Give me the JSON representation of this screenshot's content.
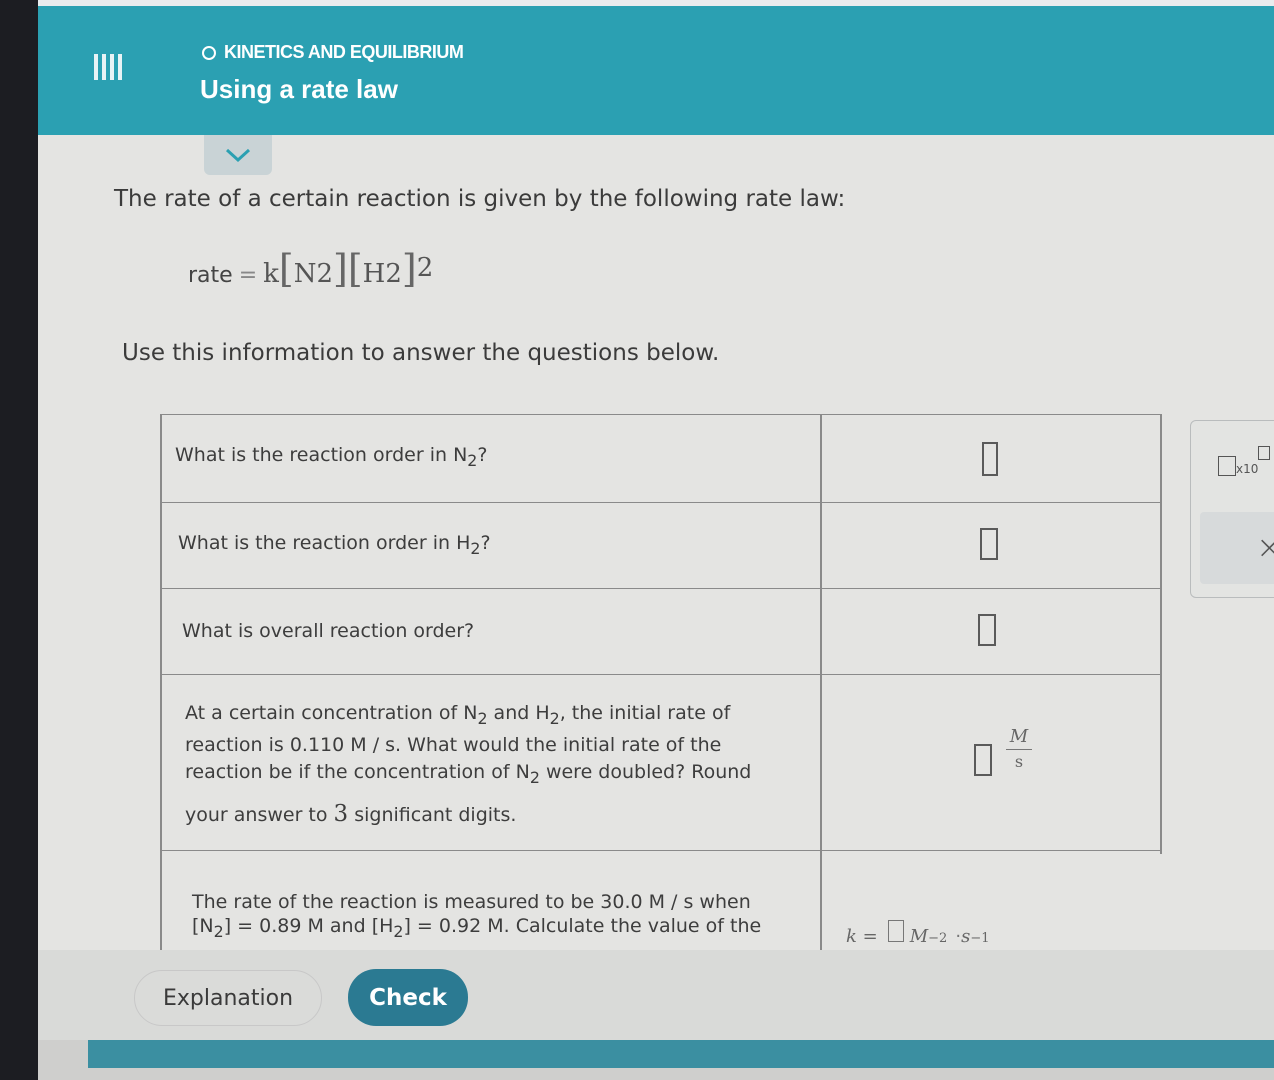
{
  "header": {
    "topic": "KINETICS AND EQUILIBRIUM",
    "title": "Using a rate law"
  },
  "intro": "The rate of a certain reaction is given by the following rate law:",
  "rate_law": {
    "lhs": "rate",
    "eq": "=",
    "k": "k",
    "n": "N",
    "h": "H",
    "sub": "2",
    "exp": "2"
  },
  "use_info": "Use this information to answer the questions below.",
  "questions": {
    "q1": {
      "pre": "What is the reaction order in N",
      "sub": "2",
      "post": "?"
    },
    "q2": {
      "pre": "What is the reaction order in H",
      "sub": "2",
      "post": "?"
    },
    "q3": {
      "text": "What is overall reaction order?"
    },
    "q4": {
      "l1a": "At a certain concentration of N",
      "l1sub1": "2",
      "l1b": " and H",
      "l1sub2": "2",
      "l1c": ", the initial rate of",
      "l2": "reaction is 0.110 M / s. What would the initial rate of the",
      "l3a": "reaction be if the concentration of N",
      "l3sub": "2",
      "l3b": " were doubled? Round",
      "l4a": "your answer to ",
      "l4num": "3",
      "l4b": " significant digits.",
      "unit_num": "M",
      "unit_den": "s"
    },
    "q5": {
      "l1": "The rate of the reaction is measured to be 30.0 M / s when",
      "l2a": "[N",
      "l2sub1": "2",
      "l2b": "] = 0.89 M and [H",
      "l2sub2": "2",
      "l2c": "] = 0.92 M. Calculate the value of the",
      "k_label": "k =",
      "unit_m": "M",
      "unit_m_exp": "−2",
      "unit_dot": "·",
      "unit_s": "s",
      "unit_s_exp": "−1"
    }
  },
  "side_panel": {
    "x10": "x10",
    "close": "×"
  },
  "buttons": {
    "explanation": "Explanation",
    "check": "Check"
  },
  "colors": {
    "header": "#2ba0b2",
    "check_button": "#2b7a92"
  }
}
